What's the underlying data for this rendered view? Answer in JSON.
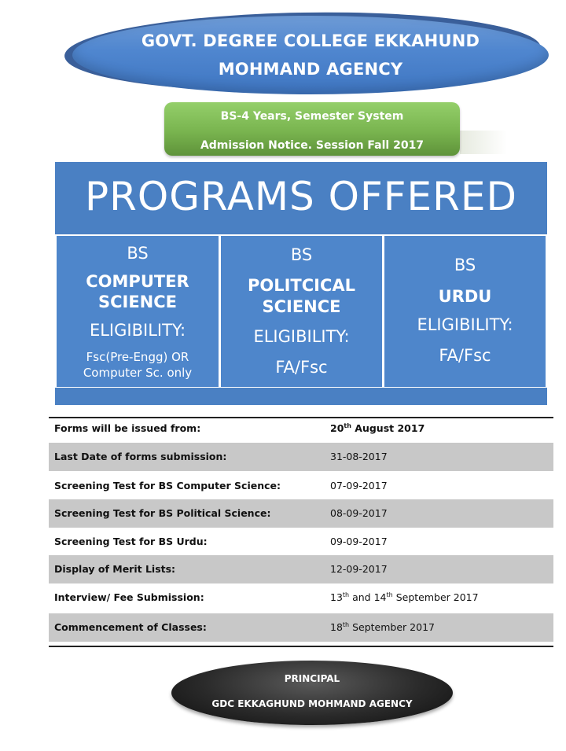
{
  "header": {
    "college_line1": "GOVT. DEGREE COLLEGE EKKAHUND",
    "college_line2": "MOHMAND AGENCY",
    "notice_line1": "BS-4 Years, Semester System",
    "notice_line2": "Admission Notice. Session Fall 2017"
  },
  "programs": {
    "title": "PROGRAMS OFFERED",
    "items": [
      {
        "degree": "BS",
        "name_line1": "COMPUTER",
        "name_line2": "SCIENCE",
        "eligibility_label": "ELIGIBILITY:",
        "eligibility_line1": "Fsc(Pre-Engg) OR",
        "eligibility_line2": "Computer Sc. only"
      },
      {
        "degree": "BS",
        "name_line1": "POLITCICAL",
        "name_line2": "SCIENCE",
        "eligibility_label": "ELIGIBILITY:",
        "eligibility_line1": "FA/Fsc"
      },
      {
        "degree": "BS",
        "name_line1": "URDU",
        "eligibility_label": "ELIGIBILITY:",
        "eligibility_line1": "FA/Fsc"
      }
    ]
  },
  "schedule": [
    {
      "label": "Forms will be issued from:",
      "value_a": "20",
      "sup_a": "th",
      "value_b": " August 2017"
    },
    {
      "label": "Last Date of forms submission:",
      "value": "31-08-2017"
    },
    {
      "label": "Screening Test for BS Computer Science:",
      "value": "07-09-2017"
    },
    {
      "label": "Screening Test for BS Political Science:",
      "value": "08-09-2017"
    },
    {
      "label": "Screening Test for BS Urdu:",
      "value": "09-09-2017"
    },
    {
      "label": "Display of Merit Lists:",
      "value": "12-09-2017"
    },
    {
      "label": "Interview/ Fee Submission:",
      "value_a": "13",
      "sup_a": "th",
      "value_b": " and 14",
      "sup_b": "th",
      "value_c": " September 2017"
    },
    {
      "label": "Commencement of Classes:",
      "value_a": "18",
      "sup_a": "th",
      "value_b": " September 2017"
    }
  ],
  "footer": {
    "line1": "PRINCIPAL",
    "line2": "GDC EKKAGHUND MOHMAND AGENCY"
  },
  "colors": {
    "program_blue": "#4e86cb",
    "notice_green": "#79b44f",
    "row_shade": "#c8c8c8"
  }
}
